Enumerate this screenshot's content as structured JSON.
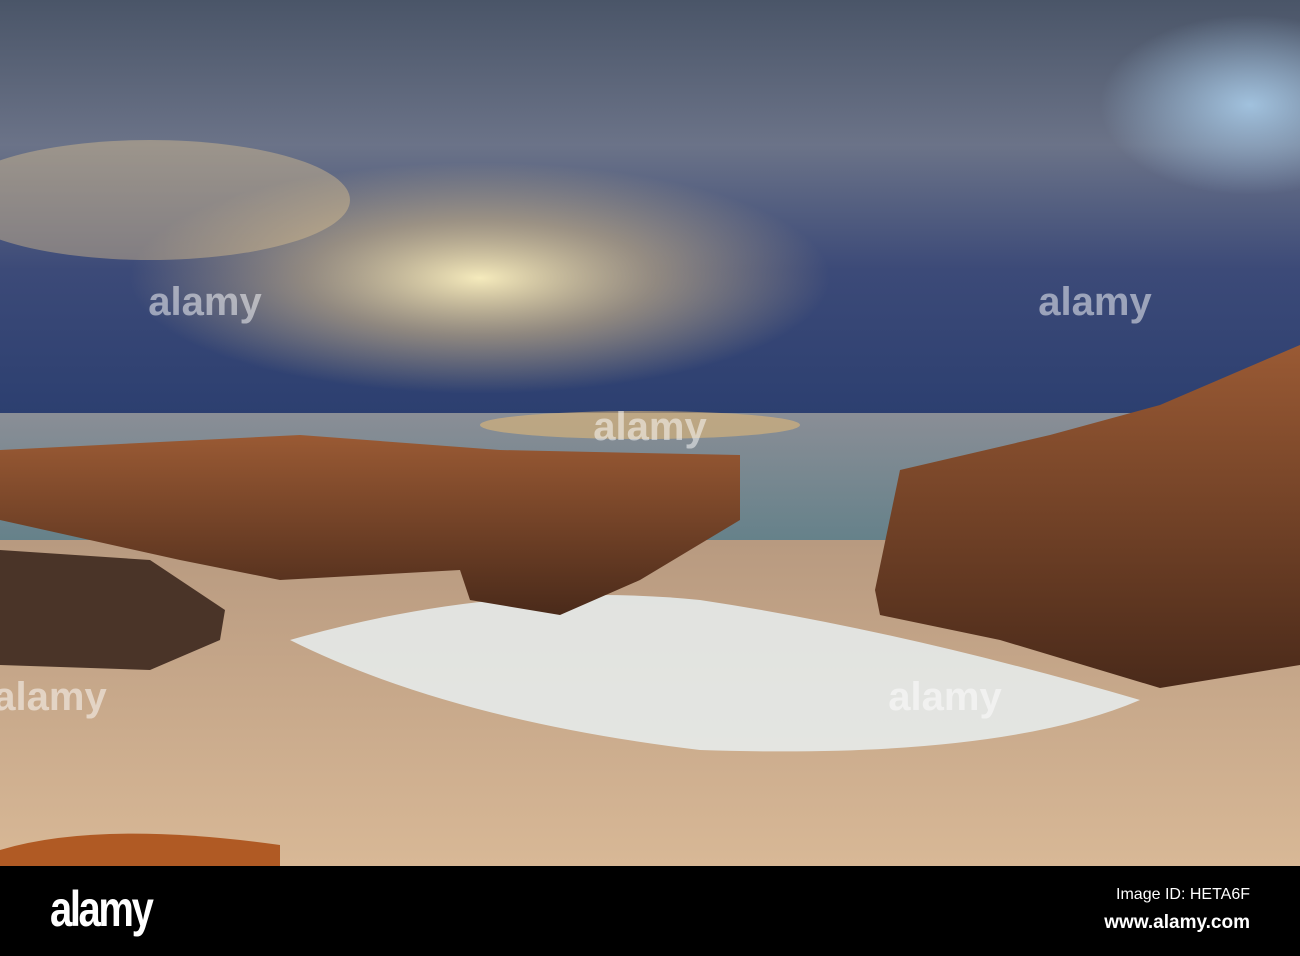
{
  "watermark": {
    "logo_text": "alamy"
  },
  "footer": {
    "logo": "alamy",
    "image_id": "Image ID: HETA6F",
    "website": "www.alamy.com"
  }
}
